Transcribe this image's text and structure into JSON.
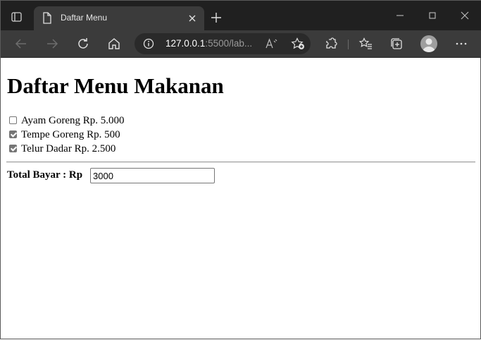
{
  "browser": {
    "tab_title": "Daftar Menu",
    "url_host": "127.0.0.1",
    "url_rest": ":5500/lab..."
  },
  "page": {
    "title": "Daftar Menu Makanan",
    "items": [
      {
        "label": "Ayam Goreng Rp. 5.000",
        "checked": false
      },
      {
        "label": "Tempe Goreng Rp. 500",
        "checked": true
      },
      {
        "label": "Telur Dadar Rp. 2.500",
        "checked": true
      }
    ],
    "total_label": "Total Bayar : Rp",
    "total_value": "3000"
  },
  "colors": {
    "tabbar_bg": "#202020",
    "toolbar_bg": "#3b3b3b",
    "checkbox_checked": "#767676"
  }
}
